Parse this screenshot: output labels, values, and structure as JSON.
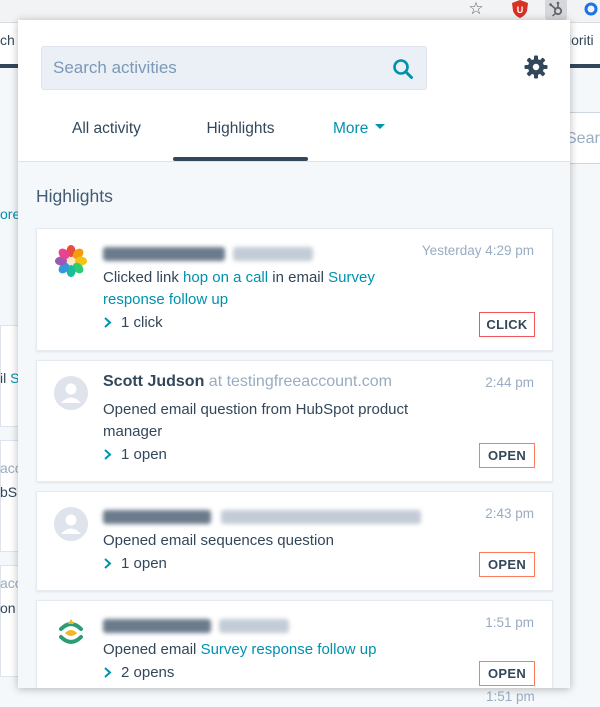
{
  "background": {
    "nav_left_fragment": "ch",
    "nav_right_fragment": "ioriti",
    "left_fragments": [
      "ore",
      "il",
      "S",
      "acc",
      "bS",
      "acc",
      "on"
    ],
    "right_fragment": "Sear",
    "last_time": "1:51 pm"
  },
  "popup": {
    "search": {
      "placeholder": "Search activities"
    },
    "tabs": {
      "all": "All activity",
      "highlights": "Highlights",
      "more": "More"
    },
    "section_title": "Highlights",
    "cards": [
      {
        "time": "Yesterday 4:29 pm",
        "desc_prefix": "Clicked link ",
        "link1": "hop on a call",
        "desc_middle": " in email ",
        "link2": "Survey response follow up",
        "count": "1 click",
        "badge": "CLICK",
        "badge_color": "#f2545b"
      },
      {
        "name": "Scott Judson",
        "at": "at testingfreeaccount.com",
        "time": "2:44 pm",
        "desc": "Opened email question from HubSpot product manager",
        "count": "1 open",
        "badge": "OPEN",
        "badge_color": "#ff7a59"
      },
      {
        "time": "2:43 pm",
        "desc": "Opened email sequences question",
        "count": "1 open",
        "badge": "OPEN",
        "badge_color": "#ff7a59"
      },
      {
        "time": "1:51 pm",
        "desc_prefix": "Opened email ",
        "link": "Survey response follow up",
        "count": "2 opens",
        "badge": "OPEN",
        "badge_color": "#ff7a59"
      }
    ]
  },
  "colors": {
    "accent": "#0091ae",
    "text": "#33475b",
    "muted": "#99acc2",
    "click_badge": "#f2545b",
    "open_badge": "#ff7a59"
  }
}
